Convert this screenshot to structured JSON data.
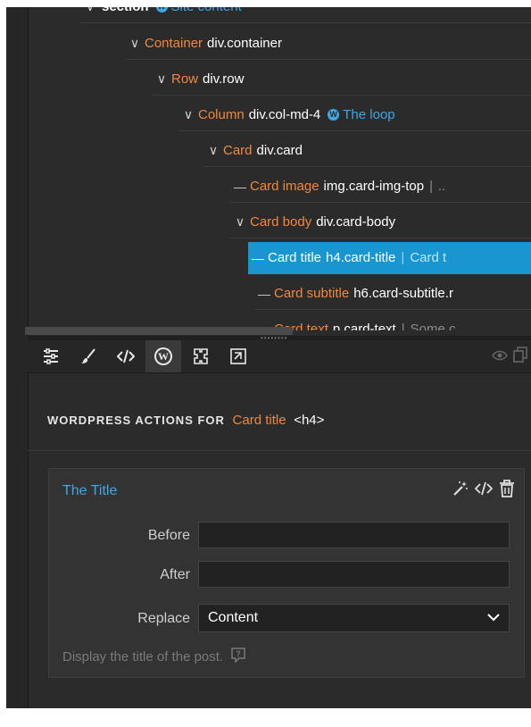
{
  "tree": {
    "rows": [
      {
        "type": "section",
        "cls": "",
        "loop": "Site content",
        "glyph": "v",
        "selected": false,
        "truncated": true
      },
      {
        "type": "Container",
        "cls": "div.container",
        "glyph": "v",
        "selected": false
      },
      {
        "type": "Row",
        "cls": "div.row",
        "glyph": "v",
        "selected": false
      },
      {
        "type": "Column",
        "cls": "div.col-md-4",
        "loop": "The loop",
        "glyph": "v",
        "selected": false
      },
      {
        "type": "Card",
        "cls": "div.card",
        "glyph": "v",
        "selected": false
      },
      {
        "type": "Card image",
        "cls": "img.card-img-top",
        "extra": "..",
        "glyph": "—",
        "selected": false
      },
      {
        "type": "Card body",
        "cls": "div.card-body",
        "glyph": "v",
        "selected": false
      },
      {
        "type": "Card title",
        "cls": "h4.card-title",
        "extra": "Card t",
        "glyph": "—",
        "selected": true
      },
      {
        "type": "Card subtitle",
        "cls": "h6.card-subtitle.r",
        "glyph": "—",
        "selected": false
      },
      {
        "type": "Card text",
        "cls": "p.card-text",
        "extra": "Some c",
        "glyph": "—",
        "selected": false,
        "truncated": true
      }
    ]
  },
  "toolbar": {
    "tools": [
      "properties-icon",
      "brush-icon",
      "code-icon",
      "wordpress-icon",
      "components-icon",
      "export-icon"
    ],
    "active": "wordpress-icon"
  },
  "panel": {
    "caption": "WORDPRESS ACTIONS FOR",
    "element_name": "Card title",
    "element_tag": "<h4>"
  },
  "action": {
    "title": "The Title",
    "before_label": "Before",
    "before_value": "",
    "after_label": "After",
    "after_value": "",
    "replace_label": "Replace",
    "replace_value": "Content",
    "hint": "Display the title of the post."
  },
  "colors": {
    "accent_orange": "#f0883e",
    "accent_blue": "#3ea8e4",
    "selection": "#1996d0",
    "background": "#2b2b2b"
  }
}
